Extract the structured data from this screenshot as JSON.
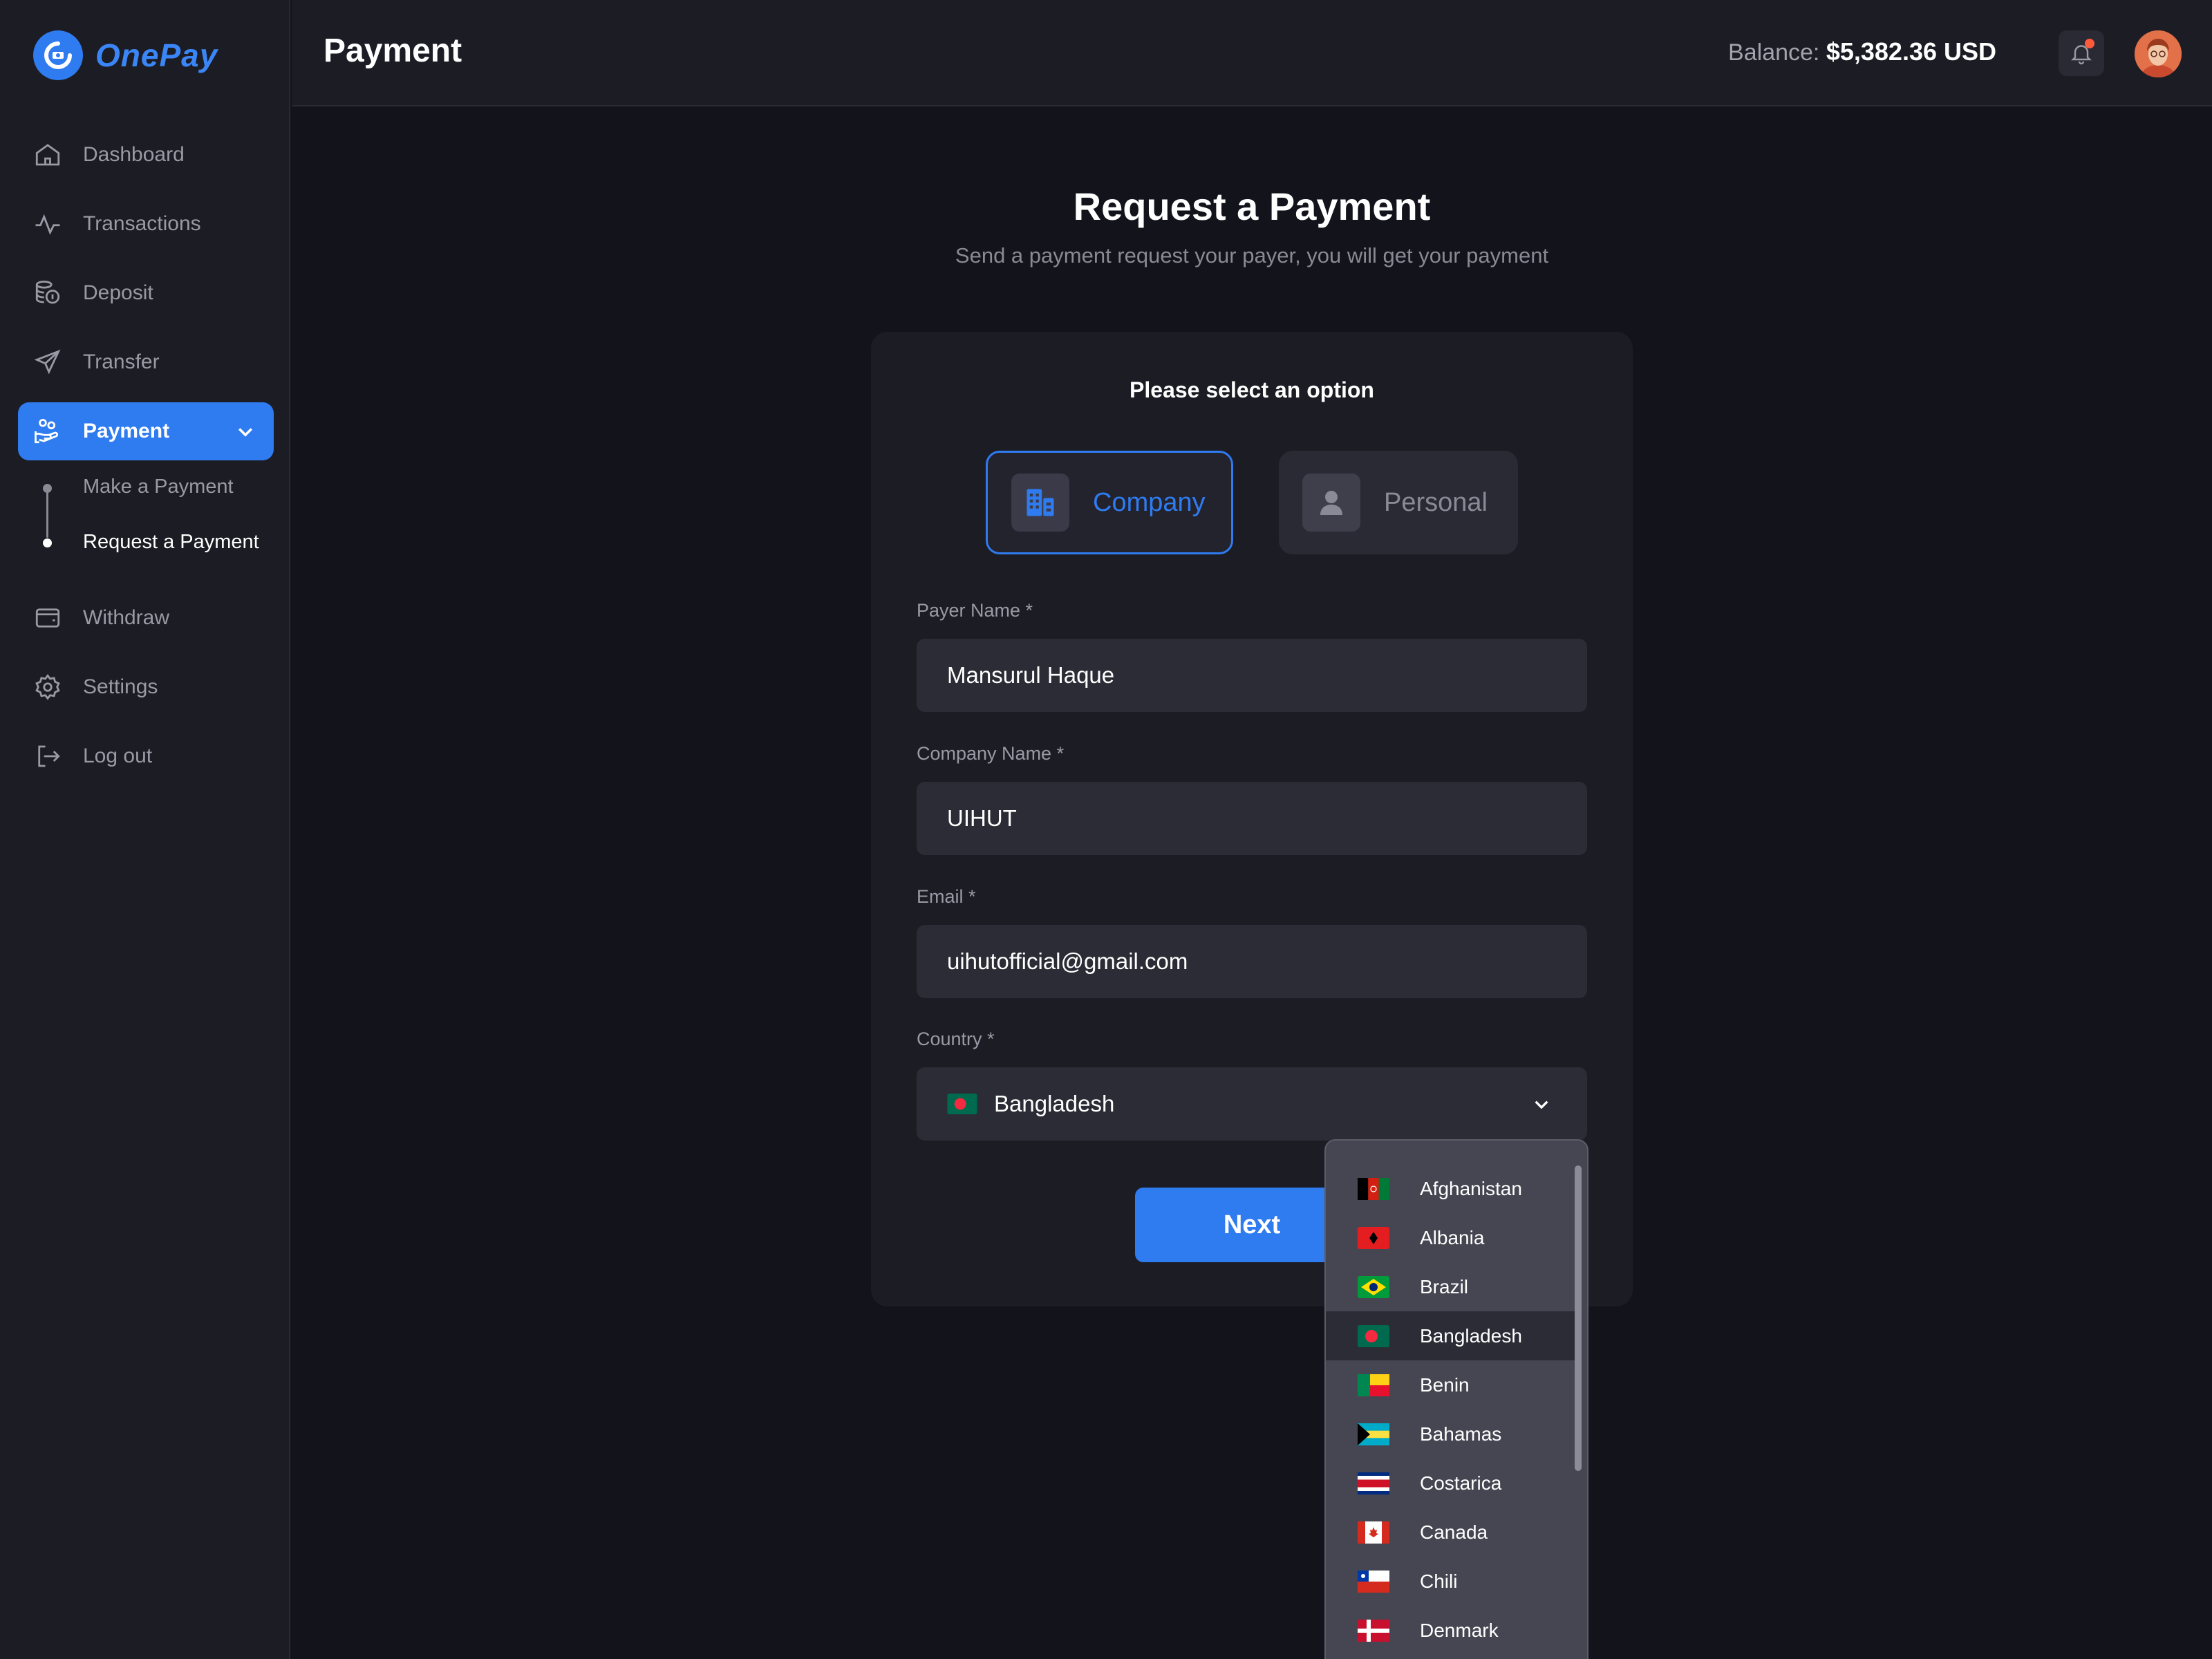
{
  "brand": {
    "name": "OnePay",
    "accent": "#2f7bf0"
  },
  "sidebar": {
    "items": [
      {
        "label": "Dashboard",
        "icon": "home-icon"
      },
      {
        "label": "Transactions",
        "icon": "activity-icon"
      },
      {
        "label": "Deposit",
        "icon": "coins-icon"
      },
      {
        "label": "Transfer",
        "icon": "send-icon"
      },
      {
        "label": "Payment",
        "icon": "hand-coin-icon",
        "active": true
      },
      {
        "label": "Withdraw",
        "icon": "wallet-icon"
      },
      {
        "label": "Settings",
        "icon": "gear-icon"
      },
      {
        "label": "Log out",
        "icon": "logout-icon"
      }
    ],
    "subitems": [
      {
        "label": "Make a Payment"
      },
      {
        "label": "Request a Payment",
        "active": true
      }
    ]
  },
  "header": {
    "title": "Payment",
    "balance_label": "Balance:",
    "balance_value": "$5,382.36 USD"
  },
  "main": {
    "title": "Request a Payment",
    "subtitle": "Send a payment request your payer, you will get your payment"
  },
  "form": {
    "heading": "Please select an option",
    "options": [
      {
        "label": "Company",
        "selected": true
      },
      {
        "label": "Personal",
        "selected": false
      }
    ],
    "payer_name_label": "Payer Name *",
    "payer_name_value": "Mansurul Haque",
    "company_name_label": "Company Name *",
    "company_name_value": "UIHUT",
    "email_label": "Email *",
    "email_value": "uihutofficial@gmail.com",
    "country_label": "Country *",
    "country_value": "Bangladesh",
    "next_label": "Next"
  },
  "country_dropdown": {
    "options": [
      "Afghanistan",
      "Albania",
      "Brazil",
      "Bangladesh",
      "Benin",
      "Bahamas",
      "Costarica",
      "Canada",
      "Chili",
      "Denmark"
    ],
    "selected": "Bangladesh"
  }
}
